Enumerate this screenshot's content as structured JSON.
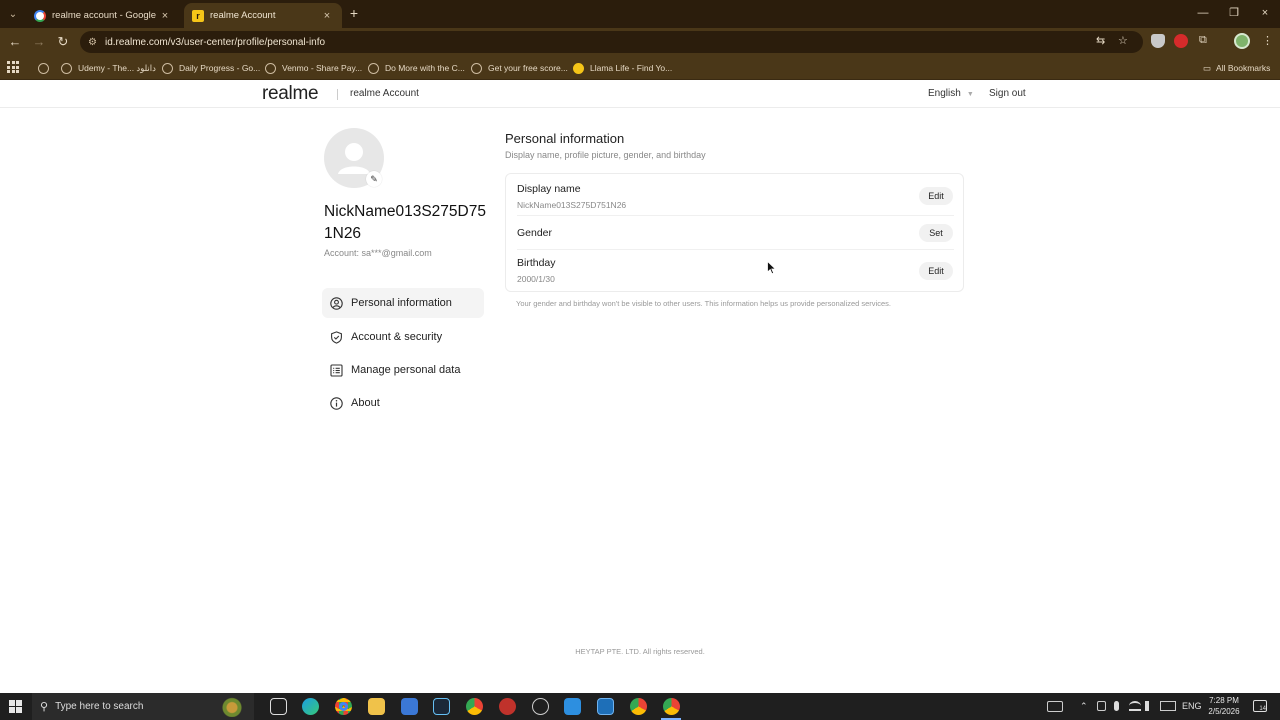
{
  "browser": {
    "tabs": [
      {
        "title": "realme account - Google Search",
        "favicon": "google-icon",
        "active": false
      },
      {
        "title": "realme Account",
        "favicon": "realme-favicon",
        "active": true
      }
    ],
    "url": "id.realme.com/v3/user-center/profile/personal-info",
    "bookmarks": [
      "Udemy - The... دانلود",
      "Daily Progress - Go...",
      "Venmo - Share Pay...",
      "Do More with the C...",
      "Get your free score...",
      "Llama Life - Find Yo..."
    ],
    "all_bookmarks": "All Bookmarks",
    "icons": {
      "close": "×",
      "new_tab": "+",
      "minimize": "—",
      "restore": "❐",
      "back": "←",
      "forward": "→",
      "reload": "↻",
      "site_info": "⚙",
      "translate": "⇆",
      "star": "☆",
      "extensions": "⧉",
      "folder": "▭",
      "tab_list": "⌄"
    }
  },
  "header": {
    "logo": "realme",
    "title": "realme Account",
    "language": "English",
    "caret": "▼",
    "sign_out": "Sign out"
  },
  "profile": {
    "edit_glyph": "✎",
    "nickname": "NickName013S275D751N26",
    "account_label": "Account:",
    "account_value": "sa***@gmail.com"
  },
  "sidebar": {
    "items": [
      {
        "label": "Personal information",
        "icon": "user-icon",
        "selected": true
      },
      {
        "label": "Account & security",
        "icon": "shield-icon",
        "selected": false
      },
      {
        "label": "Manage personal data",
        "icon": "list-icon",
        "selected": false
      },
      {
        "label": "About",
        "icon": "info-icon",
        "selected": false
      }
    ]
  },
  "main": {
    "title": "Personal information",
    "subtitle": "Display name, profile picture, gender, and birthday",
    "rows": [
      {
        "label": "Display name",
        "value": "NickName013S275D751N26",
        "action": "Edit"
      },
      {
        "label": "Gender",
        "value": "",
        "action": "Set"
      },
      {
        "label": "Birthday",
        "value": "2000/1/30",
        "action": "Edit"
      }
    ],
    "note": "Your gender and birthday won't be visible to other users. This information helps us provide personalized services."
  },
  "footer": "HEYTAP PTE. LTD. All rights reserved.",
  "taskbar": {
    "search_placeholder": "Type here to search",
    "search_glyph": "⚲",
    "language": "ENG",
    "time": "7:28 PM",
    "date": "2/5/2026",
    "notifications": "14",
    "tray_chevron": "⌃"
  },
  "colors": {
    "chrome_dark": "#2b1d0c",
    "chrome_mid": "#4a3718",
    "taskbar": "#1f1f1f"
  }
}
